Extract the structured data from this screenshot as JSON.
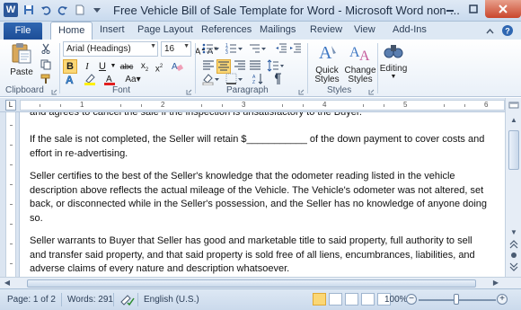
{
  "window": {
    "title": "Free Vehicle Bill of Sale Template for Word  -  Microsoft Word non-...",
    "app_icon_letter": "W"
  },
  "tabs": {
    "file": "File",
    "items": [
      "Home",
      "Insert",
      "Page Layout",
      "References",
      "Mailings",
      "Review",
      "View",
      "Add-Ins"
    ],
    "active": "Home"
  },
  "ribbon": {
    "clipboard": {
      "paste": "Paste",
      "label": "Clipboard"
    },
    "font": {
      "name": "Arial (Headings)",
      "size": "16",
      "label": "Font",
      "aa_label": "Aa"
    },
    "paragraph": {
      "label": "Paragraph"
    },
    "styles": {
      "quick_styles": "Quick Styles",
      "change_styles": "Change Styles",
      "label": "Styles"
    },
    "editing": {
      "label": "Editing"
    }
  },
  "ruler": {
    "numbers": [
      "1",
      "2",
      "3",
      "4",
      "5",
      "6"
    ]
  },
  "document": {
    "paragraphs": [
      "and agrees to cancel the sale if the inspection is unsatisfactory to the Buyer.",
      "If the sale is not completed, the Seller will retain $___________ of the down payment to cover costs and effort in re-advertising.",
      "Seller certifies to the best of the Seller's knowledge that the odometer reading listed in the vehicle description above reflects the actual mileage of the Vehicle. The Vehicle's odometer was not altered, set back, or disconnected while in the Seller's possession,  and the Seller has no knowledge of anyone doing so.",
      "Seller warrants to Buyer that Seller has good and marketable title to said property, full authority to sell and transfer said property, and that said property is sold free of all liens, encumbrances, liabilities,  and adverse claims of every nature and description whatsoever."
    ]
  },
  "status": {
    "page": "Page: 1 of 2",
    "words": "Words: 291",
    "language": "English (U.S.)",
    "zoom": "100%",
    "zoom_minus": "−",
    "zoom_plus": "+"
  },
  "colors": {
    "file_tab": "#2b579a",
    "ribbon_bg": "#e9f0f8",
    "highlight": "#fbd775"
  }
}
